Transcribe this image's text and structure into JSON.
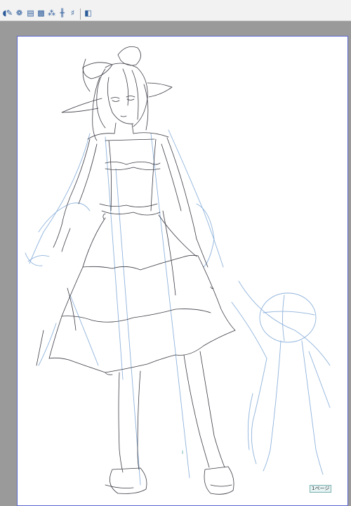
{
  "toolbar": {
    "tools": [
      {
        "icon": "dot-icon",
        "glyph": "◖"
      },
      {
        "icon": "pen-brush-icon",
        "glyph": "✎"
      },
      {
        "icon": "stroke-icon",
        "glyph": "❁"
      },
      {
        "icon": "layer-icon",
        "glyph": "▤"
      },
      {
        "icon": "hatch-icon",
        "glyph": "▩"
      },
      {
        "icon": "radial-lines-icon",
        "glyph": "⁂"
      },
      {
        "icon": "parallel-lines-icon",
        "glyph": "╫"
      },
      {
        "icon": "grid-lines-icon",
        "glyph": "♯"
      },
      {
        "icon": "panel-icon",
        "glyph": "◧"
      }
    ]
  },
  "page": {
    "label": "1ページ",
    "marker": "I"
  },
  "colors": {
    "pencil": "#3b3b45",
    "blue_sketch": "#8fb3dc",
    "paper_border": "#5a66cc"
  }
}
